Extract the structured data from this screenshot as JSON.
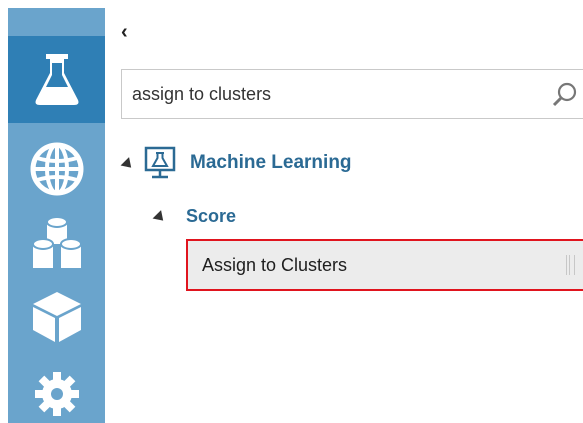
{
  "sidebar": {
    "items": [
      {
        "icon": "flask-icon",
        "active": true
      },
      {
        "icon": "globe-icon",
        "active": false
      },
      {
        "icon": "datasets-icon",
        "active": false
      },
      {
        "icon": "cube-icon",
        "active": false
      },
      {
        "icon": "gear-icon",
        "active": false
      }
    ],
    "colors": {
      "background": "#6aa4cc",
      "active": "#2f7fb5"
    }
  },
  "back": {
    "glyph": "‹"
  },
  "search": {
    "value": "assign to clusters",
    "icon": "search-icon"
  },
  "tree": {
    "category": {
      "label": "Machine Learning",
      "icon": "machine-learning-icon",
      "expanded": true
    },
    "subcategory": {
      "label": "Score",
      "expanded": true
    },
    "items": [
      {
        "label": "Assign to Clusters",
        "highlighted": true
      }
    ]
  },
  "colors": {
    "link": "#2b6a94",
    "highlight_border": "#e0141e",
    "item_background": "#ececec"
  }
}
